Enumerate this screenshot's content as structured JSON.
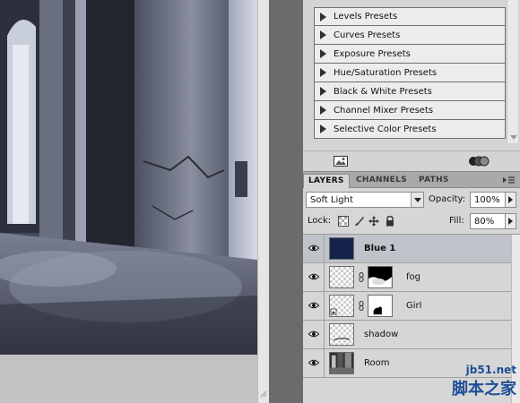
{
  "presets_panel": {
    "items": [
      "Levels Presets",
      "Curves Presets",
      "Exposure Presets",
      "Hue/Saturation Presets",
      "Black & White Presets",
      "Channel Mixer Presets",
      "Selective Color Presets"
    ],
    "footer_icons": [
      "layer-mask-icon",
      "clip-circles-icon"
    ]
  },
  "layers_panel": {
    "tabs": [
      "LAYERS",
      "CHANNELS",
      "PATHS"
    ],
    "active_tab": "LAYERS",
    "blend_mode": "Soft Light",
    "opacity_label": "Opacity:",
    "opacity_value": "100%",
    "lock_label": "Lock:",
    "lock_icons": [
      "lock-transparency-icon",
      "lock-brush-icon",
      "lock-move-icon",
      "lock-all-icon"
    ],
    "fill_label": "Fill:",
    "fill_value": "80%",
    "layers": [
      {
        "name": "Blue 1",
        "thumb": "solid navy",
        "selected": true
      },
      {
        "name": "fog",
        "thumb": "transparent with mask"
      },
      {
        "name": "Girl",
        "thumb": "transparent with mask"
      },
      {
        "name": "shadow",
        "thumb": "transparent"
      },
      {
        "name": "Room",
        "thumb": "photo"
      }
    ]
  },
  "watermark": {
    "site": "jb51.net",
    "cn": "脚本之家"
  },
  "colors": {
    "selected_layer": "#c1c3cb",
    "navy_fill": "#14234a",
    "watermark_blue": "#1e4f96"
  }
}
